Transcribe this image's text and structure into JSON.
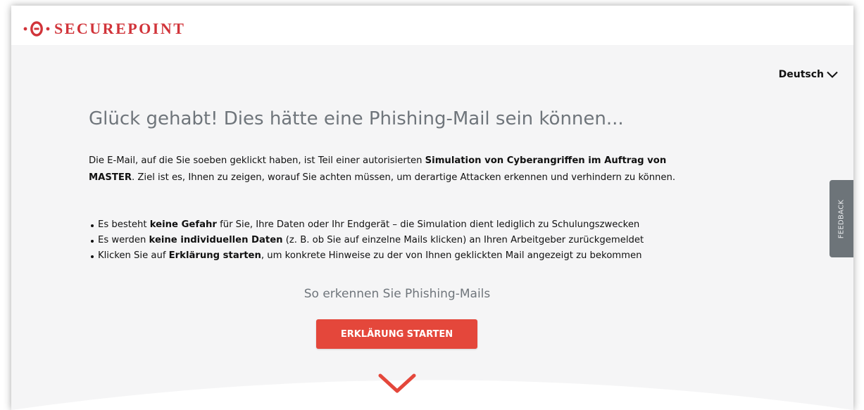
{
  "brand": {
    "name": "SECUREPOINT",
    "accent": "#d1343a"
  },
  "language": {
    "selected": "Deutsch",
    "icon": "chevron-down-icon"
  },
  "headline": "Glück gehabt! Dies hätte eine Phishing-Mail sein können...",
  "intro": {
    "text_1": "Die E-Mail, auf die Sie soeben geklickt haben, ist Teil einer autorisierten ",
    "bold_1": "Simulation von Cyberangriffen im Auftrag von MASTER",
    "text_2": ". Ziel ist es, Ihnen zu zeigen, worauf Sie achten müssen, um derartige Attacken erkennen und verhindern zu können."
  },
  "bullets": [
    {
      "pre": "Es besteht ",
      "bold": "keine Gefahr",
      "post": " für Sie, Ihre Daten oder Ihr Endgerät – die Simulation dient lediglich zu Schulungszwecken"
    },
    {
      "pre": "Es werden ",
      "bold": "keine individuellen Daten",
      "post": " (z. B. ob Sie auf einzelne Mails klicken) an Ihren Arbeitgeber zurückgemeldet"
    },
    {
      "pre": "Klicken Sie auf ",
      "bold": "Erklärung starten",
      "post": ", um konkrete Hinweise zu der von Ihnen geklickten Mail angezeigt zu bekommen"
    }
  ],
  "subhead": "So erkennen Sie Phishing-Mails",
  "cta": {
    "label": "ERKLÄRUNG STARTEN",
    "color": "#e4473b"
  },
  "scroll_down": {
    "icon": "chevron-down-icon",
    "color": "#e4473b"
  },
  "feedback_tab": {
    "label": "FEEDBACK"
  }
}
